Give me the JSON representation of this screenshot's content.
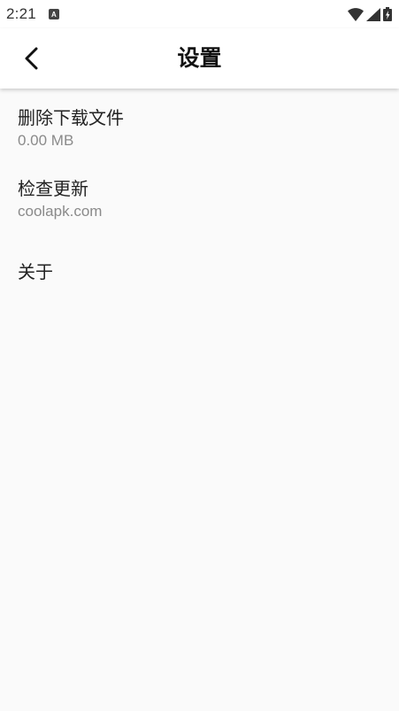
{
  "status_bar": {
    "time": "2:21",
    "notification_icon": "A",
    "icons": [
      "wifi-icon",
      "cell-signal-icon",
      "battery-charging-icon"
    ]
  },
  "app_bar": {
    "title": "设置",
    "back_icon": "chevron-left-icon"
  },
  "settings": {
    "items": [
      {
        "title": "删除下载文件",
        "subtitle": "0.00 MB"
      },
      {
        "title": "检查更新",
        "subtitle": "coolapk.com"
      },
      {
        "title": "关于",
        "subtitle": ""
      }
    ]
  }
}
